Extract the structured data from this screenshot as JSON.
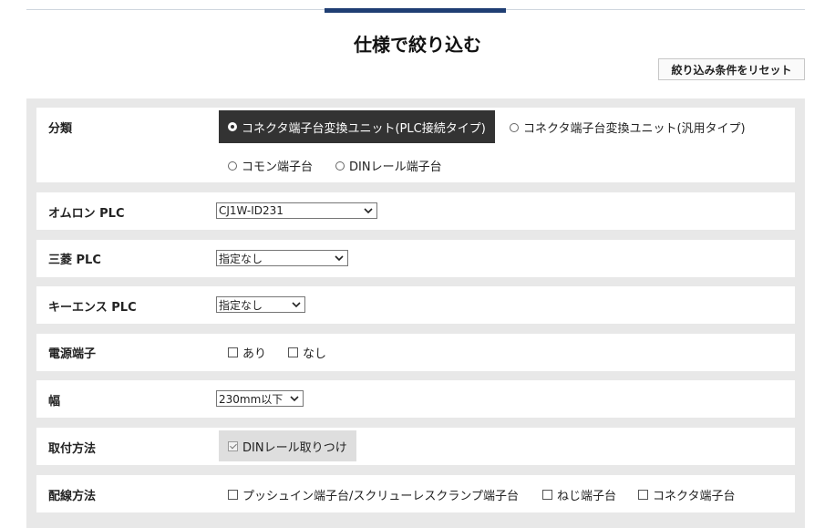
{
  "title": "仕様で絞り込む",
  "reset_button": "絞り込み条件をリセット",
  "rows": {
    "category": {
      "label": "分類",
      "options": [
        {
          "label": "コネクタ端子台変換ユニット(PLC接続タイプ)",
          "checked": true
        },
        {
          "label": "コネクタ端子台変換ユニット(汎用タイプ)",
          "checked": false
        },
        {
          "label": "コモン端子台",
          "checked": false
        },
        {
          "label": "DINレール端子台",
          "checked": false
        }
      ]
    },
    "omron": {
      "label": "オムロン PLC",
      "selected": "CJ1W-ID231"
    },
    "mitsubishi": {
      "label": "三菱 PLC",
      "selected": "指定なし"
    },
    "keyence": {
      "label": "キーエンス PLC",
      "selected": "指定なし"
    },
    "power_terminal": {
      "label": "電源端子",
      "options": [
        {
          "label": "あり",
          "checked": false
        },
        {
          "label": "なし",
          "checked": false
        }
      ]
    },
    "width": {
      "label": "幅",
      "selected": "230mm以下"
    },
    "mounting": {
      "label": "取付方法",
      "options": [
        {
          "label": "DINレール取りつけ",
          "checked": true
        }
      ]
    },
    "wiring": {
      "label": "配線方法",
      "options": [
        {
          "label": "プッシュイン端子台/スクリューレスクランプ端子台",
          "checked": false
        },
        {
          "label": "ねじ端子台",
          "checked": false
        },
        {
          "label": "コネクタ端子台",
          "checked": false
        }
      ]
    }
  },
  "icons": {
    "dropdown": "chevron-down-icon"
  }
}
